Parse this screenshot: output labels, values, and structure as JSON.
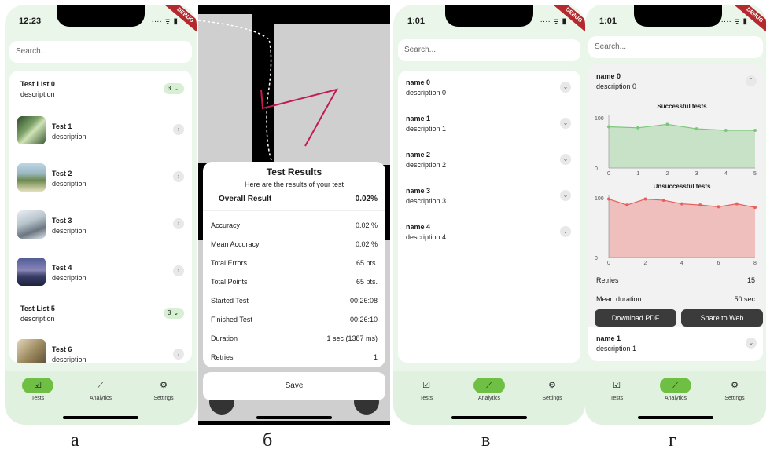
{
  "captions": [
    "а",
    "б",
    "в",
    "г"
  ],
  "colors": {
    "accent": "#6fbf45",
    "success": "#7bc77a",
    "fail": "#e8605d",
    "debug": "#b5282e"
  },
  "p1": {
    "time": "12:23",
    "status_icons": "····  ᯤ ▮",
    "debug": "DEBUG",
    "search_placeholder": "Search...",
    "group0": {
      "title": "Test List 0",
      "desc": "description",
      "badge": "3"
    },
    "group5": {
      "title": "Test List 5",
      "desc": "description",
      "badge": "3"
    },
    "items": [
      {
        "title": "Test 1",
        "desc": "description"
      },
      {
        "title": "Test 2",
        "desc": "description"
      },
      {
        "title": "Test 3",
        "desc": "description"
      },
      {
        "title": "Test 4",
        "desc": "description"
      },
      {
        "title": "Test 6",
        "desc": "description"
      }
    ],
    "nav": [
      {
        "label": "Tests",
        "icon": "☑"
      },
      {
        "label": "Analytics",
        "icon": "⟋"
      },
      {
        "label": "Settings",
        "icon": "⚙"
      }
    ]
  },
  "p2": {
    "title": "Test Results",
    "subtitle": "Here are the results of your test",
    "overall_label": "Overall Result",
    "overall_value": "0.02%",
    "rows": [
      {
        "label": "Accuracy",
        "value": "0.02 %"
      },
      {
        "label": "Mean Accuracy",
        "value": "0.02 %"
      },
      {
        "label": "Total Errors",
        "value": "65 pts."
      },
      {
        "label": "Total Points",
        "value": "65 pts."
      },
      {
        "label": "Started Test",
        "value": "00:26:08"
      },
      {
        "label": "Finished Test",
        "value": "00:26:10"
      },
      {
        "label": "Duration",
        "value": "1 sec (1387 ms)"
      },
      {
        "label": "Retries",
        "value": "1"
      }
    ],
    "save": "Save"
  },
  "p3": {
    "time": "1:01",
    "search_placeholder": "Search...",
    "items": [
      {
        "title": "name 0",
        "desc": "description 0"
      },
      {
        "title": "name 1",
        "desc": "description 1"
      },
      {
        "title": "name 2",
        "desc": "description 2"
      },
      {
        "title": "name 3",
        "desc": "description 3"
      },
      {
        "title": "name 4",
        "desc": "description 4"
      }
    ],
    "nav": [
      {
        "label": "Tests",
        "icon": "☑"
      },
      {
        "label": "Analytics",
        "icon": "⟋"
      },
      {
        "label": "Settings",
        "icon": "⚙"
      }
    ]
  },
  "p4": {
    "time": "1:01",
    "search_placeholder": "Search...",
    "item0": {
      "title": "name 0",
      "desc": "description 0"
    },
    "item1": {
      "title": "name 1",
      "desc": "description 1"
    },
    "retries_label": "Retries",
    "retries_value": "15",
    "mean_label": "Mean duration",
    "mean_value": "50 sec",
    "download": "Download PDF",
    "share": "Share to Web",
    "nav": [
      {
        "label": "Tests",
        "icon": "☑"
      },
      {
        "label": "Analytics",
        "icon": "⟋"
      },
      {
        "label": "Settings",
        "icon": "⚙"
      }
    ]
  },
  "chart_data": [
    {
      "type": "area",
      "title": "Successful tests",
      "x": [
        0,
        1,
        2,
        3,
        4,
        5
      ],
      "values": [
        82,
        80,
        87,
        78,
        75,
        75
      ],
      "xlim": [
        0,
        5
      ],
      "ylim": [
        0,
        100
      ],
      "yticks": [
        0,
        100
      ],
      "xticks": [
        0,
        1,
        2,
        3,
        4,
        5
      ],
      "color": "#7bc77a"
    },
    {
      "type": "area",
      "title": "Unsuccessful tests",
      "x": [
        0,
        1,
        2,
        3,
        4,
        5,
        6,
        7,
        8
      ],
      "values": [
        98,
        88,
        98,
        96,
        90,
        88,
        85,
        90,
        84
      ],
      "xlim": [
        0,
        8
      ],
      "ylim": [
        0,
        100
      ],
      "yticks": [
        0,
        100
      ],
      "xticks": [
        0,
        2,
        4,
        6,
        8
      ],
      "color": "#e8605d"
    }
  ]
}
